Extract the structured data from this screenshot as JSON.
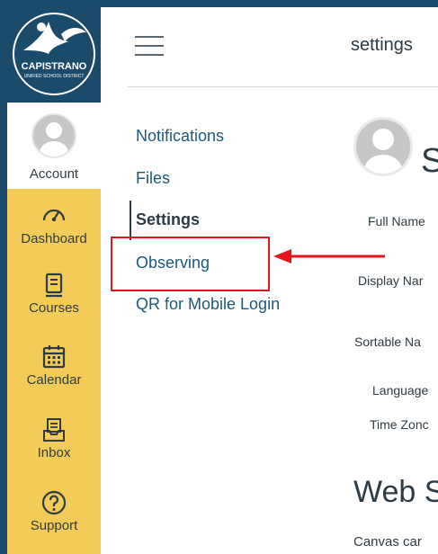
{
  "logo": {
    "name": "CAPISTRANO",
    "sub": "UNIFIED SCHOOL DISTRICT"
  },
  "global_nav": {
    "account": "Account",
    "dashboard": "Dashboard",
    "courses": "Courses",
    "calendar": "Calendar",
    "inbox": "Inbox",
    "support": "Support"
  },
  "header": {
    "breadcrumb": "settings"
  },
  "section_nav": {
    "notifications": "Notifications",
    "files": "Files",
    "settings": "Settings",
    "observing": "Observing",
    "qr": "QR for Mobile Login"
  },
  "profile": {
    "heading": "S",
    "full_name": "Full Name",
    "display_name": "Display Nar",
    "sortable_name": "Sortable Na",
    "language": "Language",
    "time_zone": "Time Zonc"
  },
  "web_services": {
    "heading": "Web S",
    "text": "Canvas car"
  },
  "colors": {
    "nav_bg": "#f3cc58",
    "brand": "#1b4a6b",
    "link": "#1d5a7e",
    "annotation": "#e5141a"
  }
}
